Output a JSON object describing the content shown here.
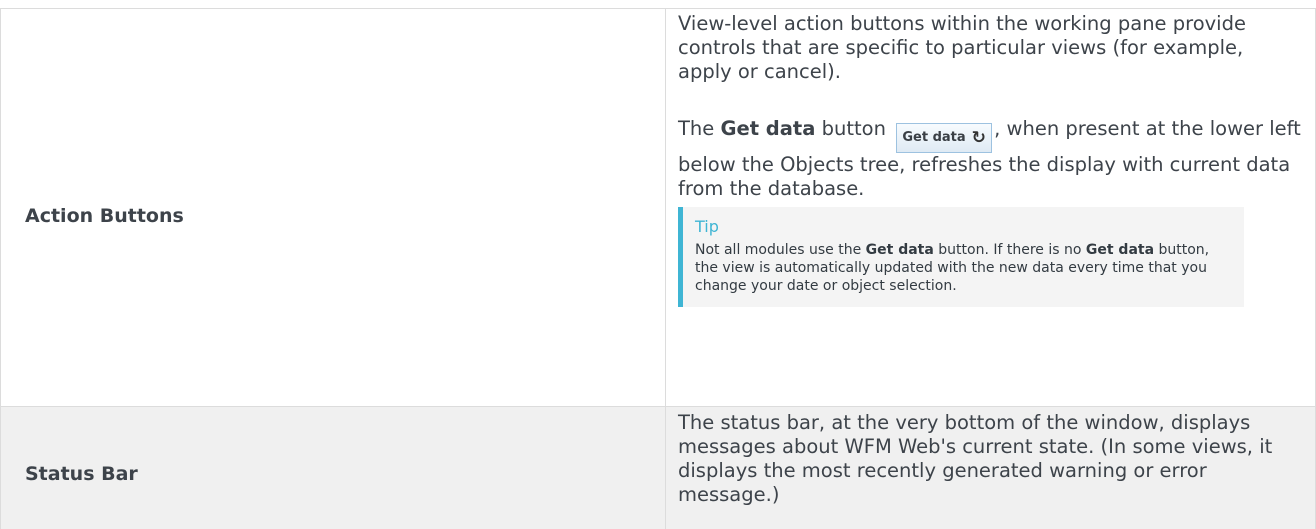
{
  "rows": [
    {
      "term": "Action Buttons",
      "desc_p1": "View-level action buttons within the working pane provide controls that are specific to particular views (for example, apply or cancel).",
      "desc_p2_pre": "The ",
      "desc_p2_bold": "Get data",
      "desc_p2_mid": " button ",
      "desc_p2_post": ", when present at the lower left below the Objects tree, refreshes the display with current data from the database.",
      "button_image": {
        "label": "Get data",
        "icon": "refresh-icon"
      },
      "tip": {
        "title": "Tip",
        "t1": "Not all modules use the ",
        "b1": "Get data",
        "t2": " button. If there is no ",
        "b2": "Get data",
        "t3": " button, the view is  automatically updated with the new data every time that you change your date or object selection."
      }
    },
    {
      "term": "Status Bar",
      "desc": "The status bar, at the very bottom of the window, displays messages about WFM Web's current state. (In some views, it displays the most recently generated warning or error message.)"
    }
  ],
  "colors": {
    "tip_accent": "#3fb5d4",
    "row_alt_bg": "#f0f0f0",
    "border": "#dcdcdc"
  }
}
